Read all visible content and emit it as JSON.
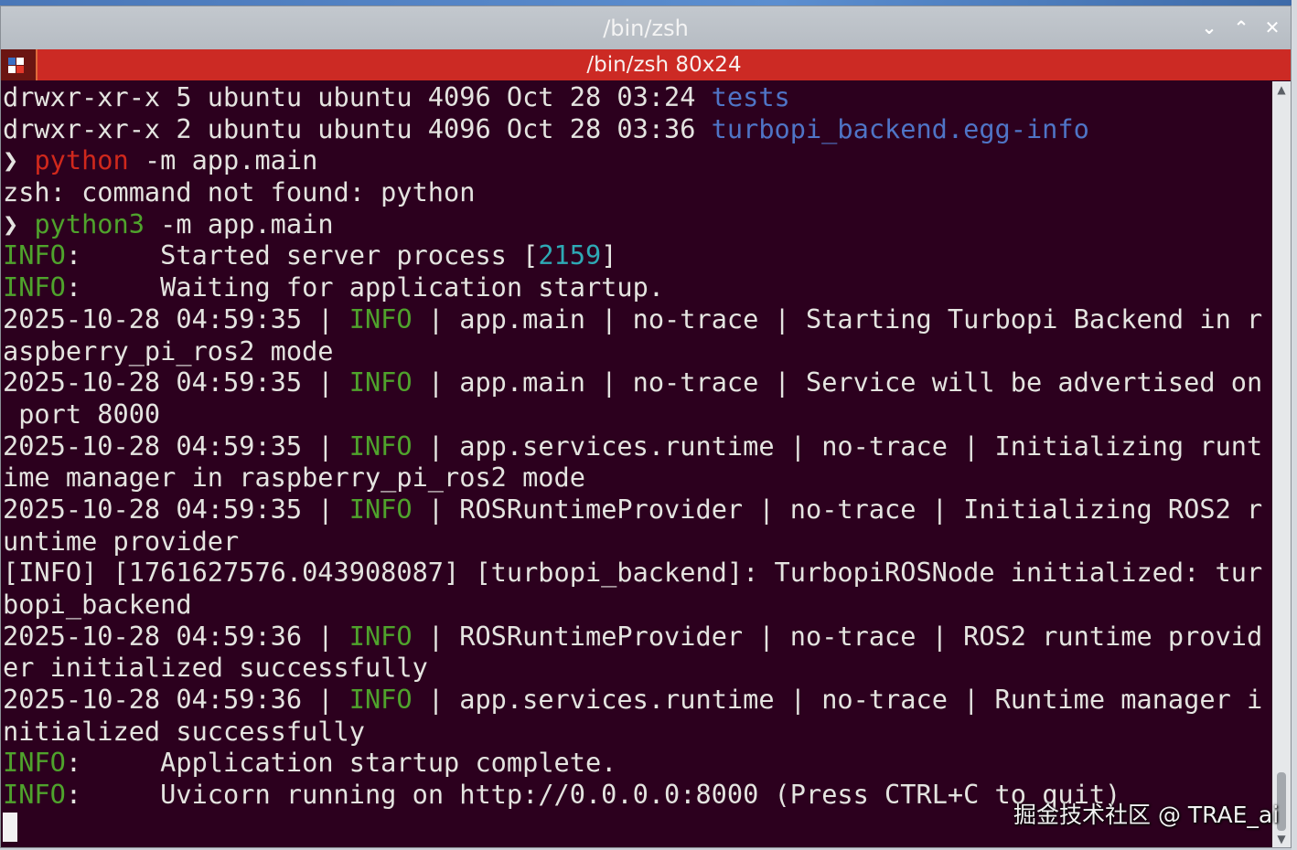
{
  "window": {
    "title": "/bin/zsh",
    "controls": {
      "minimize": "⌄",
      "maximize": "⌃",
      "close": "✕"
    }
  },
  "tab": {
    "title": "/bin/zsh 80x24",
    "icon": "terminal-app-icon"
  },
  "terminal": {
    "lines": [
      [
        {
          "t": "drwxr-xr-x 5 ubuntu ubuntu 4096 Oct 28 03:24 "
        },
        {
          "t": "tests",
          "c": "blue"
        }
      ],
      [
        {
          "t": "drwxr-xr-x 2 ubuntu ubuntu 4096 Oct 28 03:36 "
        },
        {
          "t": "turbopi_backend.egg-info",
          "c": "blue"
        }
      ],
      [
        {
          "t": "❯ "
        },
        {
          "t": "python",
          "c": "red"
        },
        {
          "t": " -m app.main"
        }
      ],
      [
        {
          "t": "zsh: command not found: python"
        }
      ],
      [
        {
          "t": "❯ "
        },
        {
          "t": "python3",
          "c": "green"
        },
        {
          "t": " -m app.main"
        }
      ],
      [
        {
          "t": "INFO",
          "c": "green"
        },
        {
          "t": ":     Started server process ["
        },
        {
          "t": "2159",
          "c": "cyan"
        },
        {
          "t": "]"
        }
      ],
      [
        {
          "t": "INFO",
          "c": "green"
        },
        {
          "t": ":     Waiting for application startup."
        }
      ],
      [
        {
          "t": "2025-10-28 04:59:35 | "
        },
        {
          "t": "INFO",
          "c": "green"
        },
        {
          "t": " | app.main | no-trace | Starting Turbopi Backend in r"
        }
      ],
      [
        {
          "t": "aspberry_pi_ros2 mode"
        }
      ],
      [
        {
          "t": "2025-10-28 04:59:35 | "
        },
        {
          "t": "INFO",
          "c": "green"
        },
        {
          "t": " | app.main | no-trace | Service will be advertised on"
        }
      ],
      [
        {
          "t": " port 8000"
        }
      ],
      [
        {
          "t": "2025-10-28 04:59:35 | "
        },
        {
          "t": "INFO",
          "c": "green"
        },
        {
          "t": " | app.services.runtime | no-trace | Initializing runt"
        }
      ],
      [
        {
          "t": "ime manager in raspberry_pi_ros2 mode"
        }
      ],
      [
        {
          "t": "2025-10-28 04:59:35 | "
        },
        {
          "t": "INFO",
          "c": "green"
        },
        {
          "t": " | ROSRuntimeProvider | no-trace | Initializing ROS2 r"
        }
      ],
      [
        {
          "t": "untime provider"
        }
      ],
      [
        {
          "t": "[INFO] [1761627576.043908087] [turbopi_backend]: TurbopiROSNode initialized: tur"
        }
      ],
      [
        {
          "t": "bopi_backend"
        }
      ],
      [
        {
          "t": "2025-10-28 04:59:36 | "
        },
        {
          "t": "INFO",
          "c": "green"
        },
        {
          "t": " | ROSRuntimeProvider | no-trace | ROS2 runtime provid"
        }
      ],
      [
        {
          "t": "er initialized successfully"
        }
      ],
      [
        {
          "t": "2025-10-28 04:59:36 | "
        },
        {
          "t": "INFO",
          "c": "green"
        },
        {
          "t": " | app.services.runtime | no-trace | Runtime manager i"
        }
      ],
      [
        {
          "t": "nitialized successfully"
        }
      ],
      [
        {
          "t": "INFO",
          "c": "green"
        },
        {
          "t": ":     Application startup complete."
        }
      ],
      [
        {
          "t": "INFO",
          "c": "green"
        },
        {
          "t": ":     Uvicorn running on http://0.0.0.0:8000 (Press CTRL+C to quit)"
        }
      ]
    ]
  },
  "colors": {
    "background": "#2c001e",
    "blue": "#4f74c6",
    "red": "#d0281c",
    "green": "#4fa32c",
    "cyan": "#2ea9b5",
    "tab_bar": "#cc2a24"
  },
  "scrollbar": {
    "up_arrow": "▲",
    "down_arrow": "▼",
    "position": 1.0
  },
  "watermark": "掘金技术社区 @ TRAE_ai"
}
